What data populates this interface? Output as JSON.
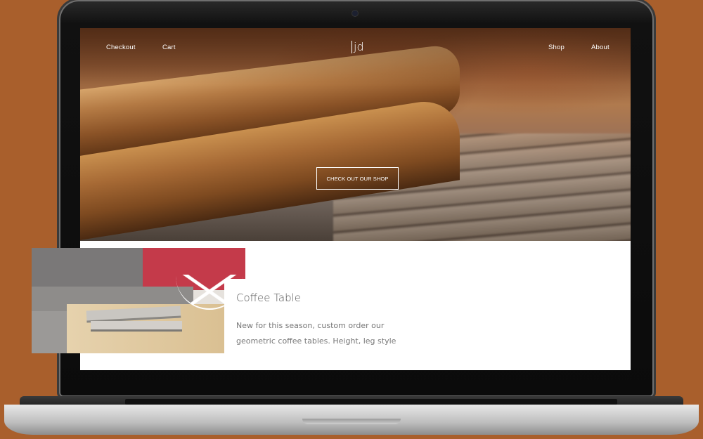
{
  "nav": {
    "left": [
      "Checkout",
      "Cart"
    ],
    "right": [
      "Shop",
      "About"
    ],
    "logo": "jd"
  },
  "hero": {
    "cta_label": "CHECK OUT OUR SHOP"
  },
  "product": {
    "title": "Coffee Table",
    "description": "New for this season, custom order our geometric coffee tables. Height, leg style"
  },
  "colors": {
    "background": "#a95f2c",
    "nav_text": "#ffffff"
  }
}
